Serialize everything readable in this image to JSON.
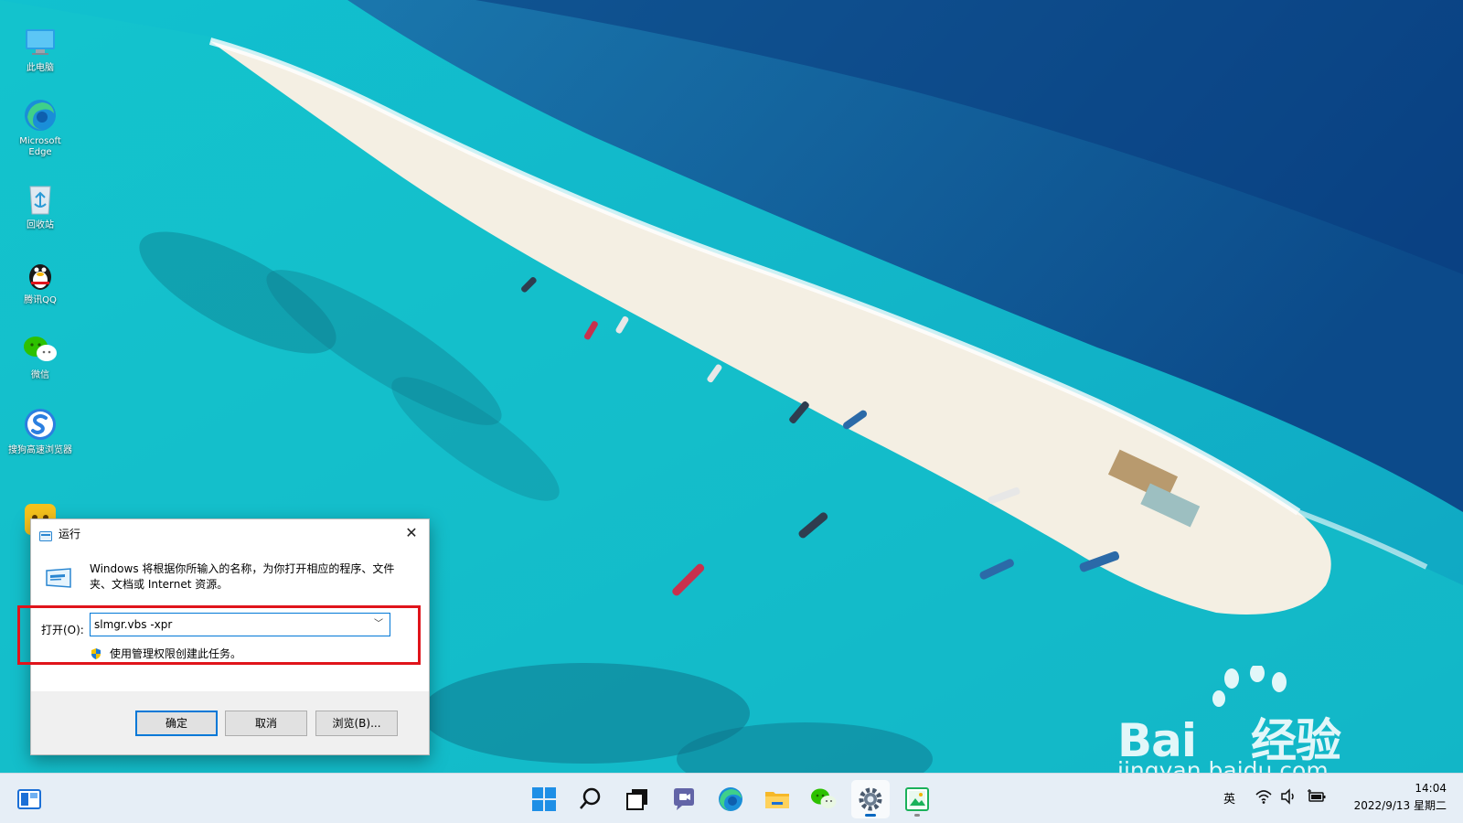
{
  "desktop": {
    "icons": [
      {
        "label": "此电脑",
        "icon": "monitor-icon"
      },
      {
        "label": "Microsoft Edge",
        "icon": "edge-icon"
      },
      {
        "label": "回收站",
        "icon": "recycle-bin-icon"
      },
      {
        "label": "腾讯QQ",
        "icon": "qq-penguin-icon"
      },
      {
        "label": "微信",
        "icon": "wechat-icon"
      },
      {
        "label": "搜狗高速浏览器",
        "icon": "sogou-browser-icon"
      }
    ]
  },
  "run_dialog": {
    "title": "运行",
    "description": "Windows 将根据你所输入的名称，为你打开相应的程序、文件夹、文档或 Internet 资源。",
    "open_label": "打开(O):",
    "input_value": "slmgr.vbs -xpr",
    "admin_note": "使用管理权限创建此任务。",
    "buttons": {
      "ok": "确定",
      "cancel": "取消",
      "browse": "浏览(B)..."
    }
  },
  "watermark": {
    "brand": "Bai",
    "brand2": "经验",
    "url": "jingyan.baidu.com"
  },
  "taskbar": {
    "language": "英",
    "time": "14:04",
    "date": "2022/9/13 星期二"
  },
  "colors": {
    "accent": "#0078d7",
    "highlight": "#e0141b",
    "taskbar_bg": "#e6eef6"
  }
}
